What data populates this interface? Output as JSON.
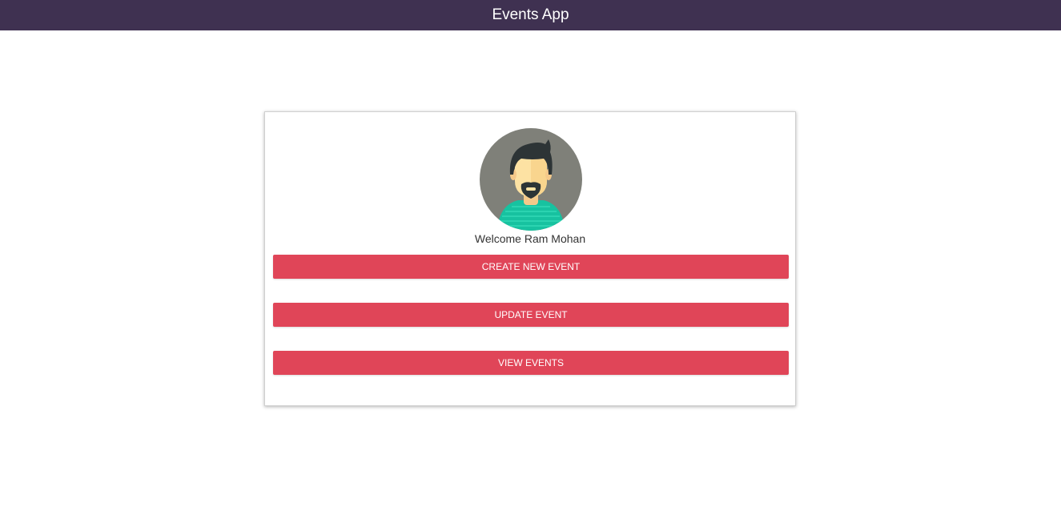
{
  "header": {
    "title": "Events App",
    "background_color": "#3f3151"
  },
  "profile": {
    "avatar_icon": "male-avatar-icon",
    "welcome_text": "Welcome Ram Mohan"
  },
  "actions": {
    "button_color": "#e04558",
    "create_label": "CREATE NEW EVENT",
    "update_label": "UPDATE EVENT",
    "view_label": "VIEW EVENTS"
  }
}
